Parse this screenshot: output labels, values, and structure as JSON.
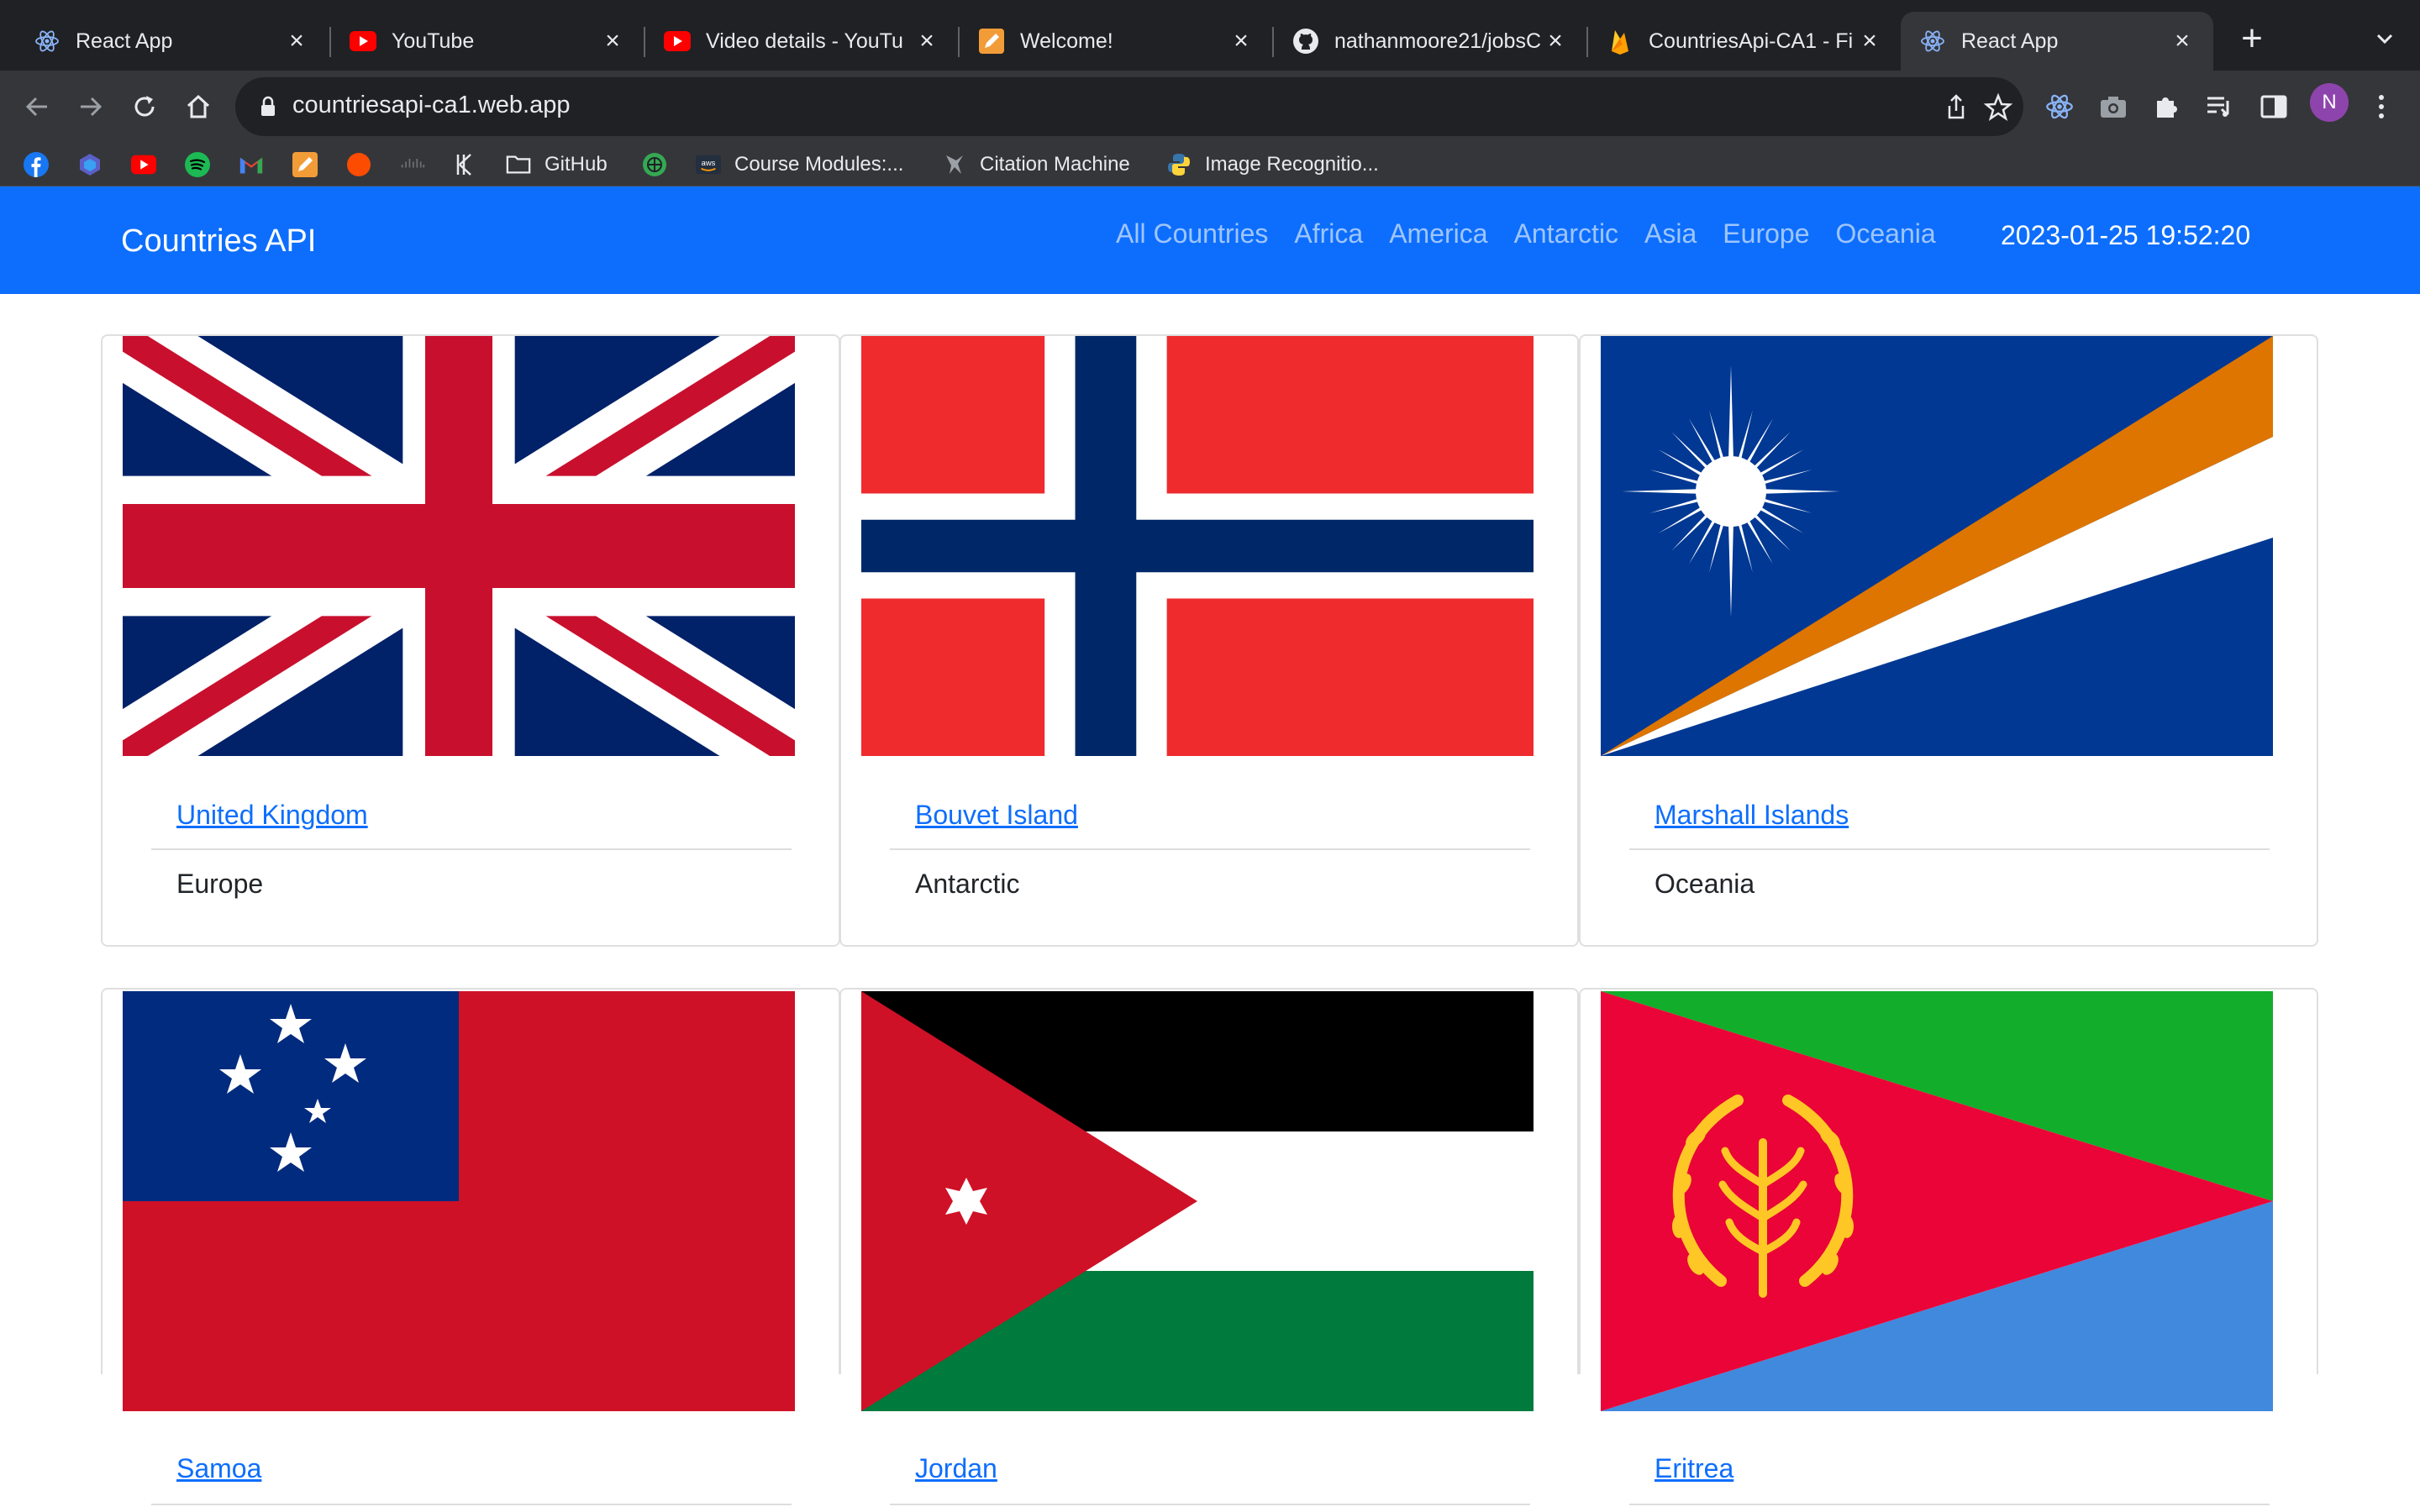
{
  "browser": {
    "tabs": [
      {
        "title": "React App",
        "icon": "react-icon",
        "active": false
      },
      {
        "title": "YouTube",
        "icon": "youtube-icon",
        "active": false
      },
      {
        "title": "Video details - YouTu",
        "icon": "youtube-icon",
        "active": false
      },
      {
        "title": "Welcome!",
        "icon": "pencil-app-icon",
        "active": false
      },
      {
        "title": "nathanmoore21/jobsC",
        "icon": "github-icon",
        "active": false
      },
      {
        "title": "CountriesApi-CA1 - Fi",
        "icon": "firebase-icon",
        "active": false
      },
      {
        "title": "React App",
        "icon": "react-icon",
        "active": true
      }
    ],
    "url": "countriesapi-ca1.web.app",
    "profile_initial": "N",
    "bookmarks": [
      {
        "label": "",
        "icon": "facebook-icon"
      },
      {
        "label": "",
        "icon": "power-automate-icon"
      },
      {
        "label": "",
        "icon": "youtube-icon"
      },
      {
        "label": "",
        "icon": "spotify-icon"
      },
      {
        "label": "",
        "icon": "gmail-icon"
      },
      {
        "label": "",
        "icon": "pencil-app-icon"
      },
      {
        "label": "",
        "icon": "orange-circle-icon"
      },
      {
        "label": "",
        "icon": "cisco-icon"
      },
      {
        "label": "",
        "icon": "k-logo-icon"
      },
      {
        "label": "GitHub",
        "icon": "folder-icon"
      },
      {
        "label": "",
        "icon": "green-globe-icon"
      },
      {
        "label": "Course Modules:...",
        "icon": "aws-icon"
      },
      {
        "label": "Citation Machine",
        "icon": "citation-icon"
      },
      {
        "label": "Image Recognitio...",
        "icon": "python-icon"
      }
    ]
  },
  "app": {
    "brand": "Countries API",
    "nav": [
      "All Countries",
      "Africa",
      "America",
      "Antarctic",
      "Asia",
      "Europe",
      "Oceania"
    ],
    "datetime": "2023-01-25 19:52:20",
    "countries": [
      {
        "name": "United Kingdom",
        "region": "Europe",
        "flag": "gb-flag"
      },
      {
        "name": "Bouvet Island",
        "region": "Antarctic",
        "flag": "bv-flag"
      },
      {
        "name": "Marshall Islands",
        "region": "Oceania",
        "flag": "mh-flag"
      },
      {
        "name": "Samoa",
        "region": "",
        "flag": "ws-flag"
      },
      {
        "name": "Jordan",
        "region": "",
        "flag": "jo-flag"
      },
      {
        "name": "Eritrea",
        "region": "",
        "flag": "er-flag"
      }
    ]
  },
  "colors": {
    "navbar": "#0d6efd",
    "link": "#0d6efd",
    "chrome_dark": "#202124",
    "chrome_toolbar": "#35363a"
  }
}
